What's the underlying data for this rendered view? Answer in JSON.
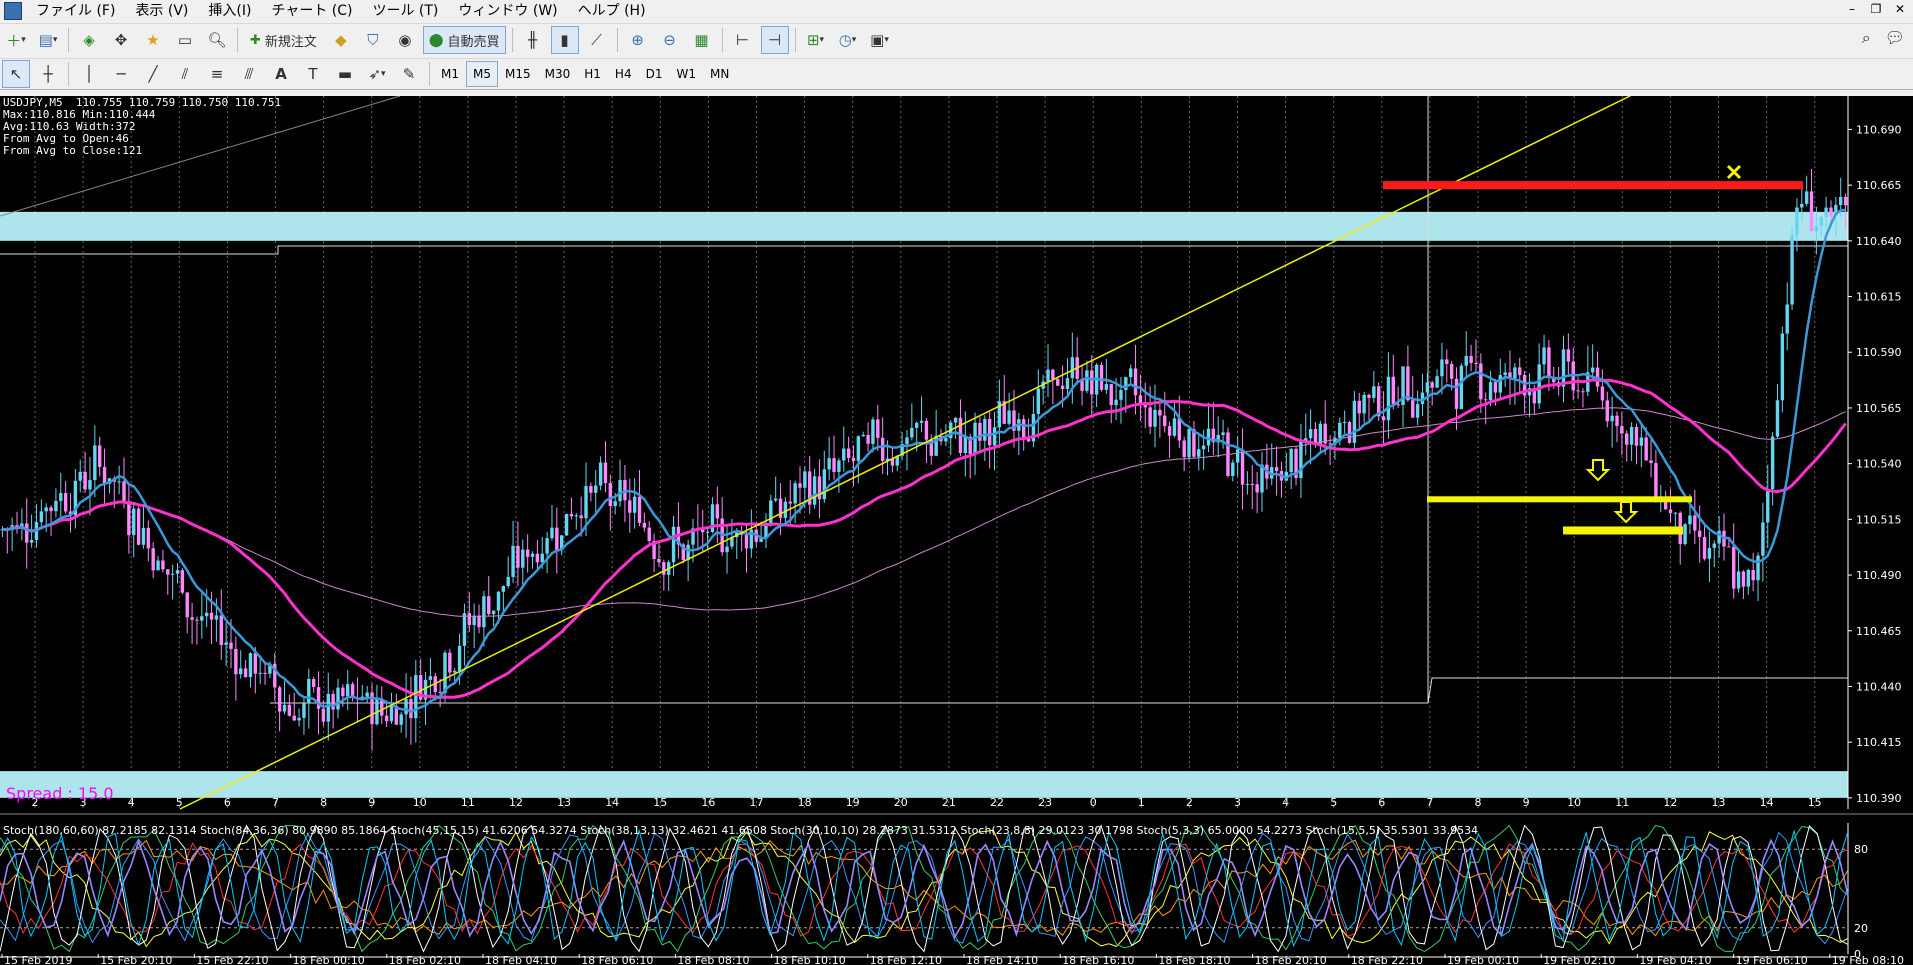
{
  "menu": {
    "items": [
      "ファイル (F)",
      "表示 (V)",
      "挿入(I)",
      "チャート (C)",
      "ツール (T)",
      "ウィンドウ (W)",
      "ヘルプ (H)"
    ]
  },
  "window_controls": [
    "–",
    "❐",
    "✕"
  ],
  "toolbar": {
    "new_order_label": "新規注文",
    "auto_trade_label": "自動売買"
  },
  "timeframes": [
    "M1",
    "M5",
    "M15",
    "M30",
    "H1",
    "H4",
    "D1",
    "W1",
    "MN"
  ],
  "active_timeframe": "M5",
  "chart": {
    "header_lines": [
      "USDJPY,M5  110.755 110.759 110.750 110.751",
      "Max:110.816 Min:110.444",
      "Avg:110.63 Width:372",
      "From Avg to Open:46",
      "From Avg to Close:121"
    ],
    "spread_label": "Spread : 15.0",
    "stoch_legend": "Stoch(180,60,60) 87.2185 82.1314  Stoch(84,36,36) 80.9890 85.1864  Stoch(45,15,15) 41.6206 54.3274  Stoch(38,13,13) 32.4621 41.6508  Stoch(30,10,10) 28.2873 31.5312  Stoch(23,8,8) 29.0123 30.1798  Stoch(5,3,3) 65.0000 54.2273  Stoch(15,5,5) 35.5301 33.9534",
    "stoch_levels": [
      "80",
      "20",
      "0"
    ],
    "colors": {
      "background": "#000000",
      "ma_fast": "#3a9ad9",
      "ma_mid": "#ff33cc",
      "ma_slow": "#cc88cc",
      "zone": "#aee4ec",
      "resistance": "#ff1a1a",
      "support": "#f5f500",
      "trendline": "#f0f000",
      "candle_up": "#66d6f0",
      "candle_down": "#ff88ff"
    }
  },
  "chart_data": {
    "type": "candlestick",
    "symbol": "USDJPY",
    "timeframe": "M5",
    "price_ticks": [
      "110.690",
      "110.665",
      "110.640",
      "110.615",
      "110.590",
      "110.565",
      "110.540",
      "110.515",
      "110.490",
      "110.465",
      "110.440",
      "110.415",
      "110.390"
    ],
    "ylim": [
      110.385,
      110.705
    ],
    "day_labels": [
      "2",
      "3",
      "4",
      "5",
      "6",
      "7",
      "8",
      "9",
      "10",
      "11",
      "12",
      "13",
      "14",
      "15",
      "16",
      "17",
      "18",
      "19",
      "20",
      "21",
      "22",
      "23",
      "0",
      "1",
      "2",
      "3",
      "4",
      "5",
      "6",
      "7",
      "8",
      "9",
      "10",
      "11",
      "12",
      "13",
      "14",
      "15"
    ],
    "time_labels": [
      "15 Feb 2019",
      "15 Feb 20:10",
      "15 Feb 22:10",
      "18 Feb 00:10",
      "18 Feb 02:10",
      "18 Feb 04:10",
      "18 Feb 06:10",
      "18 Feb 08:10",
      "18 Feb 10:10",
      "18 Feb 12:10",
      "18 Feb 14:10",
      "18 Feb 16:10",
      "18 Feb 18:10",
      "18 Feb 20:10",
      "18 Feb 22:10",
      "19 Feb 00:10",
      "19 Feb 02:10",
      "19 Feb 04:10",
      "19 Feb 06:10",
      "19 Feb 08:10"
    ],
    "bars": 380,
    "zones": [
      [
        110.64,
        110.653
      ],
      [
        110.39,
        110.402
      ]
    ],
    "resistance_level": 110.665,
    "support_levels": [
      110.524,
      110.51
    ],
    "max_price": 110.816,
    "min_price": 110.444,
    "close_price": 110.751
  }
}
